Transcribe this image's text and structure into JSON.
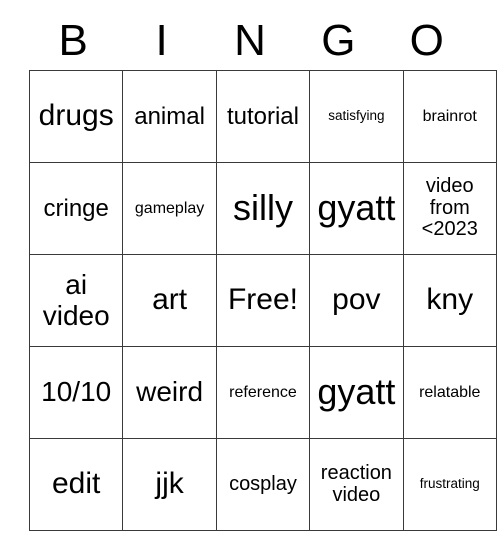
{
  "card": {
    "title_letters": [
      "B",
      "I",
      "N",
      "G",
      "O"
    ],
    "free_space": {
      "row": 2,
      "col": 2,
      "label": "Free!"
    },
    "colors": {
      "background": "#ffffff",
      "text": "#000000",
      "grid_line": "#3a3a3a"
    },
    "rows": [
      [
        {
          "text": "drugs",
          "size": "fs-xxl"
        },
        {
          "text": "animal",
          "size": "fs-lg"
        },
        {
          "text": "tutorial",
          "size": "fs-lg"
        },
        {
          "text": "satisfying",
          "size": "fs-xs"
        },
        {
          "text": "brainrot",
          "size": "fs-sm"
        }
      ],
      [
        {
          "text": "cringe",
          "size": "fs-lg"
        },
        {
          "text": "gameplay",
          "size": "fs-sm"
        },
        {
          "text": "silly",
          "size": "fs-huge"
        },
        {
          "text": "gyatt",
          "size": "fs-huge"
        },
        {
          "text": "video from <2023",
          "size": "fs-md"
        }
      ],
      [
        {
          "text": "ai video",
          "size": "fs-xl"
        },
        {
          "text": "art",
          "size": "fs-xxl"
        },
        {
          "text": "Free!",
          "size": "fs-xxl"
        },
        {
          "text": "pov",
          "size": "fs-xxl"
        },
        {
          "text": "kny",
          "size": "fs-xxl"
        }
      ],
      [
        {
          "text": "10/10",
          "size": "fs-xl"
        },
        {
          "text": "weird",
          "size": "fs-xl"
        },
        {
          "text": "reference",
          "size": "fs-sm"
        },
        {
          "text": "gyatt",
          "size": "fs-huge"
        },
        {
          "text": "relatable",
          "size": "fs-sm"
        }
      ],
      [
        {
          "text": "edit",
          "size": "fs-xxl"
        },
        {
          "text": "jjk",
          "size": "fs-xxl"
        },
        {
          "text": "cosplay",
          "size": "fs-md"
        },
        {
          "text": "reaction video",
          "size": "fs-md"
        },
        {
          "text": "frustrating",
          "size": "fs-xs"
        }
      ]
    ]
  }
}
